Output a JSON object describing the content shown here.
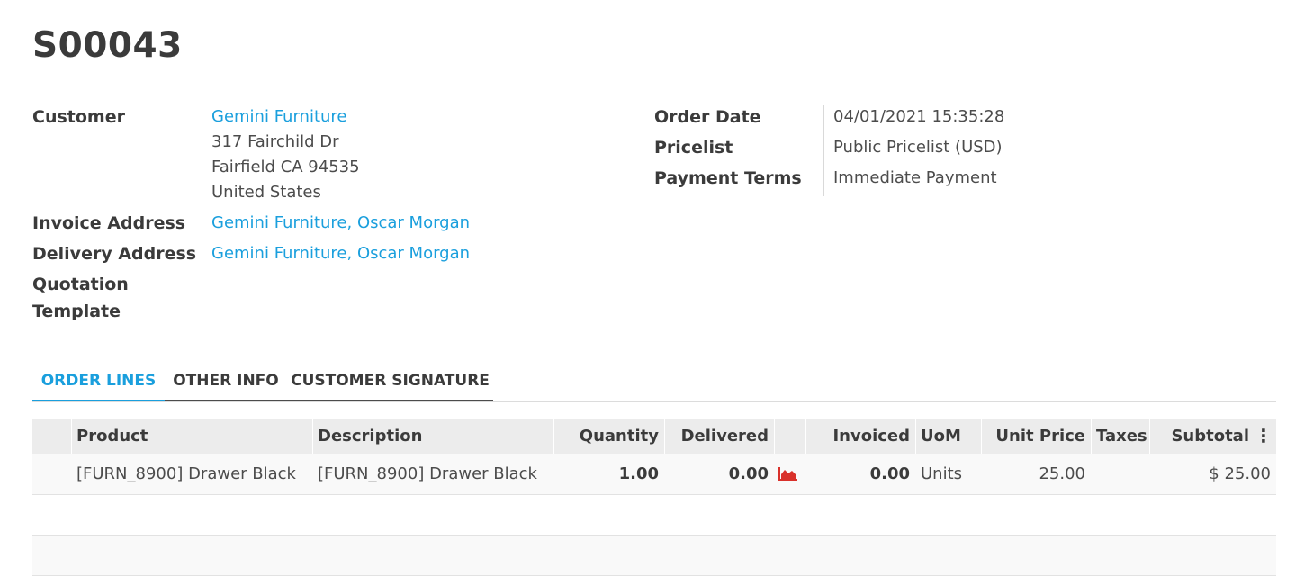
{
  "order": {
    "title": "S00043"
  },
  "left_fields": {
    "customer_label": "Customer",
    "customer_name": "Gemini Furniture",
    "customer_address_line1": "317 Fairchild Dr",
    "customer_address_line2": "Fairfield CA 94535",
    "customer_address_line3": "United States",
    "invoice_address_label": "Invoice Address",
    "invoice_address_value": "Gemini Furniture, Oscar Morgan",
    "delivery_address_label": "Delivery Address",
    "delivery_address_value": "Gemini Furniture, Oscar Morgan",
    "quotation_template_label_line1": "Quotation",
    "quotation_template_label_line2": "Template"
  },
  "right_fields": {
    "order_date_label": "Order Date",
    "order_date_value": "04/01/2021 15:35:28",
    "pricelist_label": "Pricelist",
    "pricelist_value": "Public Pricelist (USD)",
    "payment_terms_label": "Payment Terms",
    "payment_terms_value": "Immediate Payment"
  },
  "tabs": [
    {
      "label": "ORDER LINES",
      "active": true
    },
    {
      "label": "OTHER INFO",
      "active": false
    },
    {
      "label": "CUSTOMER SIGNATURE",
      "active": false
    }
  ],
  "table": {
    "headers": {
      "product": "Product",
      "description": "Description",
      "quantity": "Quantity",
      "delivered": "Delivered",
      "invoiced": "Invoiced",
      "uom": "UoM",
      "unit_price": "Unit Price",
      "taxes": "Taxes",
      "subtotal": "Subtotal",
      "options_icon": "kebab-menu-icon"
    },
    "rows": [
      {
        "product": "[FURN_8900] Drawer Black",
        "description": "[FURN_8900] Drawer Black",
        "quantity": "1.00",
        "delivered": "0.00",
        "forecast_icon": "area-chart-icon",
        "invoiced": "0.00",
        "uom": "Units",
        "unit_price": "25.00",
        "taxes": "",
        "subtotal": "$ 25.00"
      }
    ]
  },
  "colors": {
    "link": "#1a9fdd",
    "active_tab": "#1a9fdd",
    "forecast_icon": "#d9312b",
    "header_bg": "#ececec"
  }
}
